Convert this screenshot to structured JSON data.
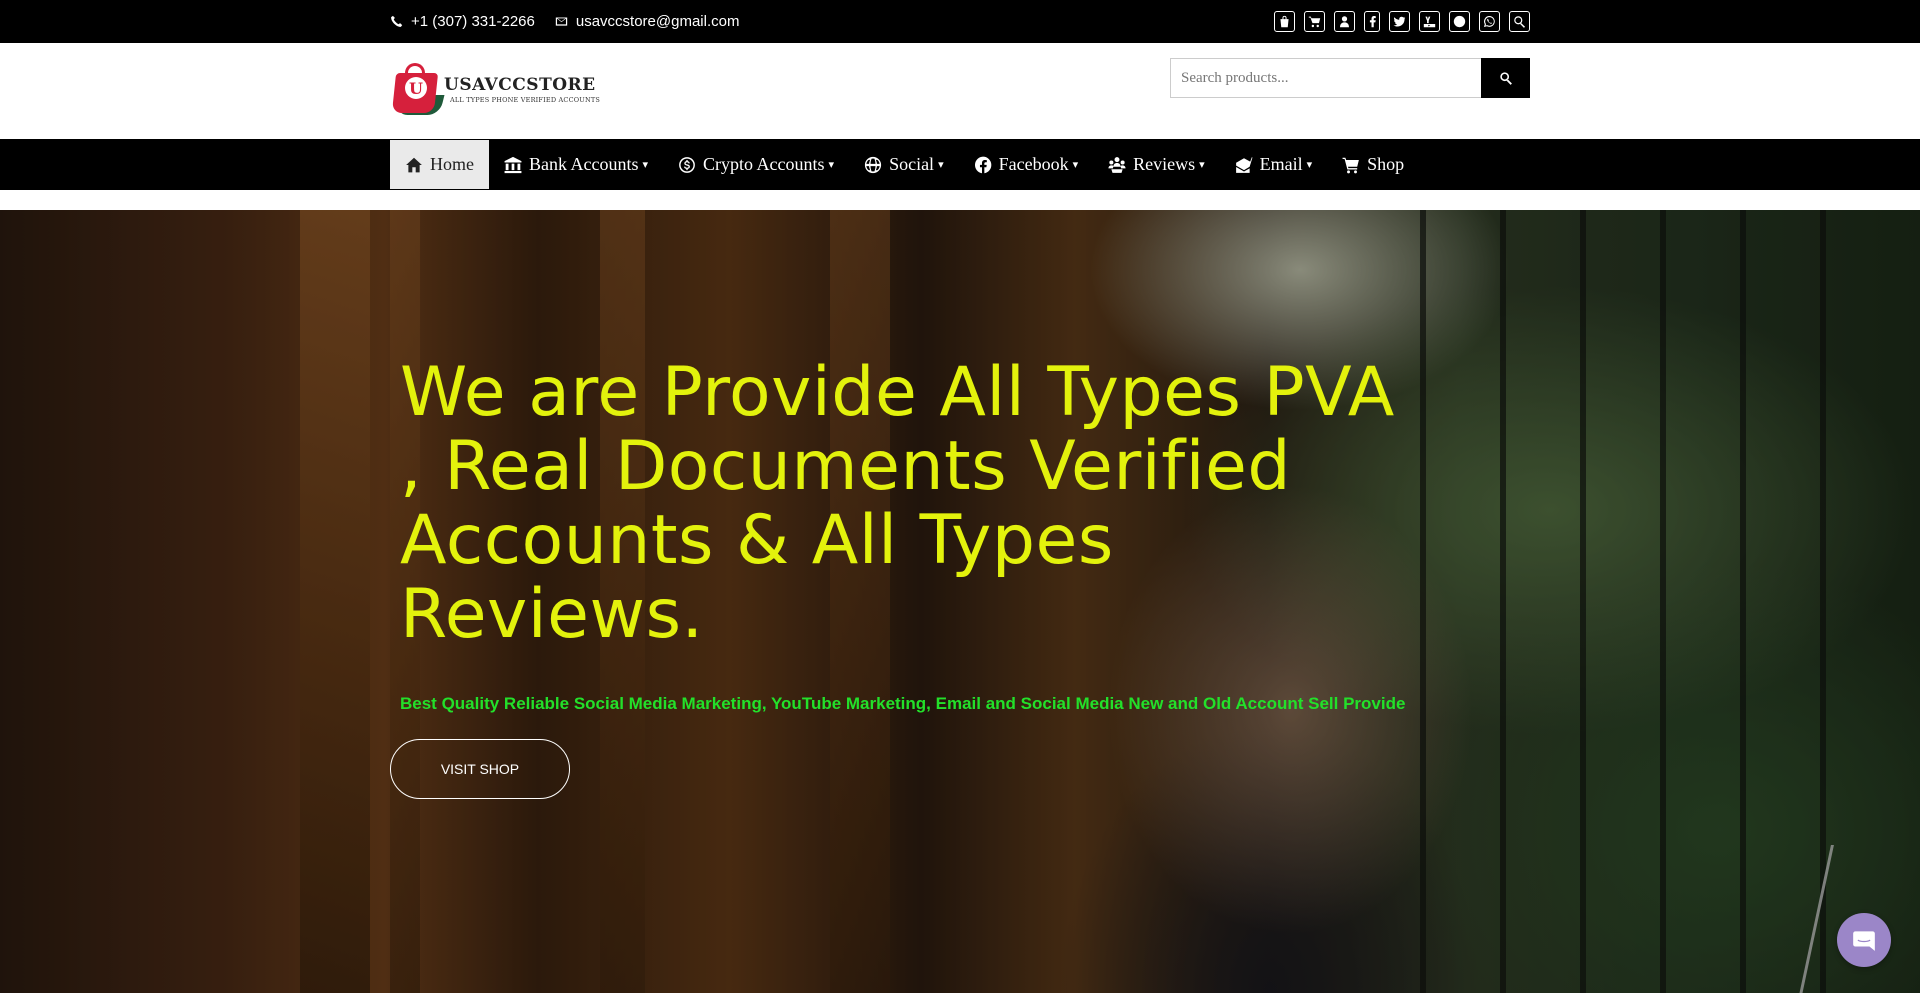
{
  "topbar": {
    "phone": "+1 (307) 331-2266",
    "email": "usavccstore@gmail.com",
    "icons": [
      "shop-bag-icon",
      "cart-icon",
      "user-icon",
      "facebook-icon",
      "twitter-icon",
      "youtube-icon",
      "telegram-icon",
      "whatsapp-icon",
      "search-icon"
    ]
  },
  "header": {
    "logo_name": "USAVCCSTORE",
    "logo_tagline": "ALL TYPES PHONE VERIFIED ACCOUNTS",
    "logo_letter": "U",
    "search_placeholder": "Search products..."
  },
  "nav": {
    "items": [
      {
        "label": "Home",
        "icon": "home-icon",
        "dropdown": false,
        "active": true
      },
      {
        "label": "Bank Accounts",
        "icon": "bank-icon",
        "dropdown": true
      },
      {
        "label": "Crypto Accounts",
        "icon": "dollar-coin-icon",
        "dropdown": true
      },
      {
        "label": "Social",
        "icon": "globe-icon",
        "dropdown": true
      },
      {
        "label": "Facebook",
        "icon": "facebook-icon",
        "dropdown": true
      },
      {
        "label": "Reviews",
        "icon": "reviews-icon",
        "dropdown": true
      },
      {
        "label": "Email",
        "icon": "email-icon",
        "dropdown": true
      },
      {
        "label": "Shop",
        "icon": "cart-icon",
        "dropdown": false
      }
    ],
    "caret": "▾"
  },
  "hero": {
    "headline": "We are Provide All Types PVA , Real Documents Verified Accounts & All Types Reviews.",
    "subheadline": "Best Quality Reliable Social Media Marketing, YouTube Marketing, Email and Social Media New and Old Account Sell Provide",
    "button_label": "VISIT SHOP"
  },
  "colors": {
    "headline": "#e3f20c",
    "subheadline": "#23e02a",
    "bar": "#000000",
    "chat": "#9b86c8"
  }
}
